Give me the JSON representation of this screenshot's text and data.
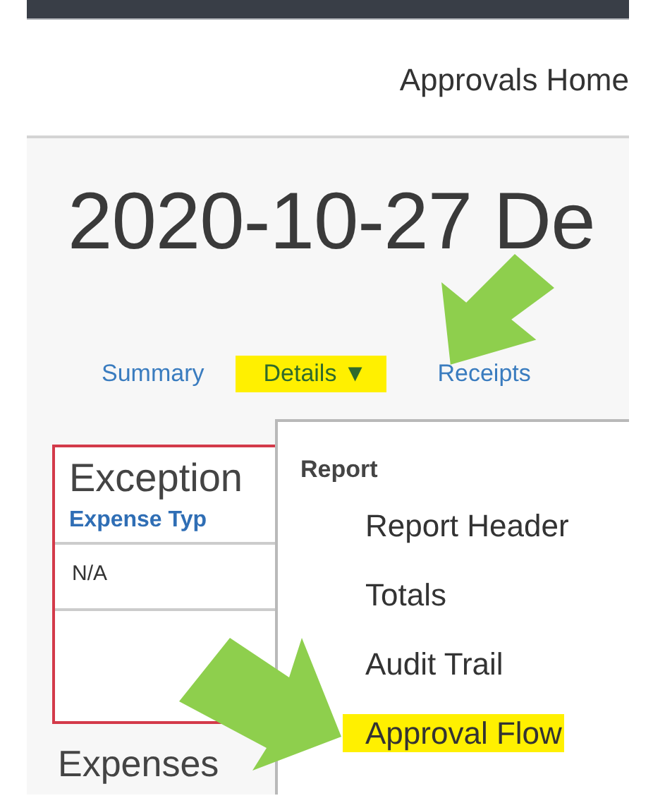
{
  "header": {
    "link": "Approvals Home"
  },
  "title": "2020-10-27 De",
  "tabs": [
    {
      "label": "Summary",
      "highlighted": false
    },
    {
      "label": "Details",
      "caret": "▼",
      "highlighted": true
    },
    {
      "label": "Receipts",
      "highlighted": false
    }
  ],
  "exceptions": {
    "title": "Exception",
    "column": "Expense Typ",
    "rows": [
      "N/A"
    ]
  },
  "section": "Expenses",
  "menu": {
    "heading": "Report",
    "items": [
      {
        "label": "Report Header",
        "highlighted": false
      },
      {
        "label": "Totals",
        "highlighted": false
      },
      {
        "label": "Audit Trail",
        "highlighted": false
      },
      {
        "label": "Approval Flow",
        "highlighted": true
      }
    ]
  }
}
